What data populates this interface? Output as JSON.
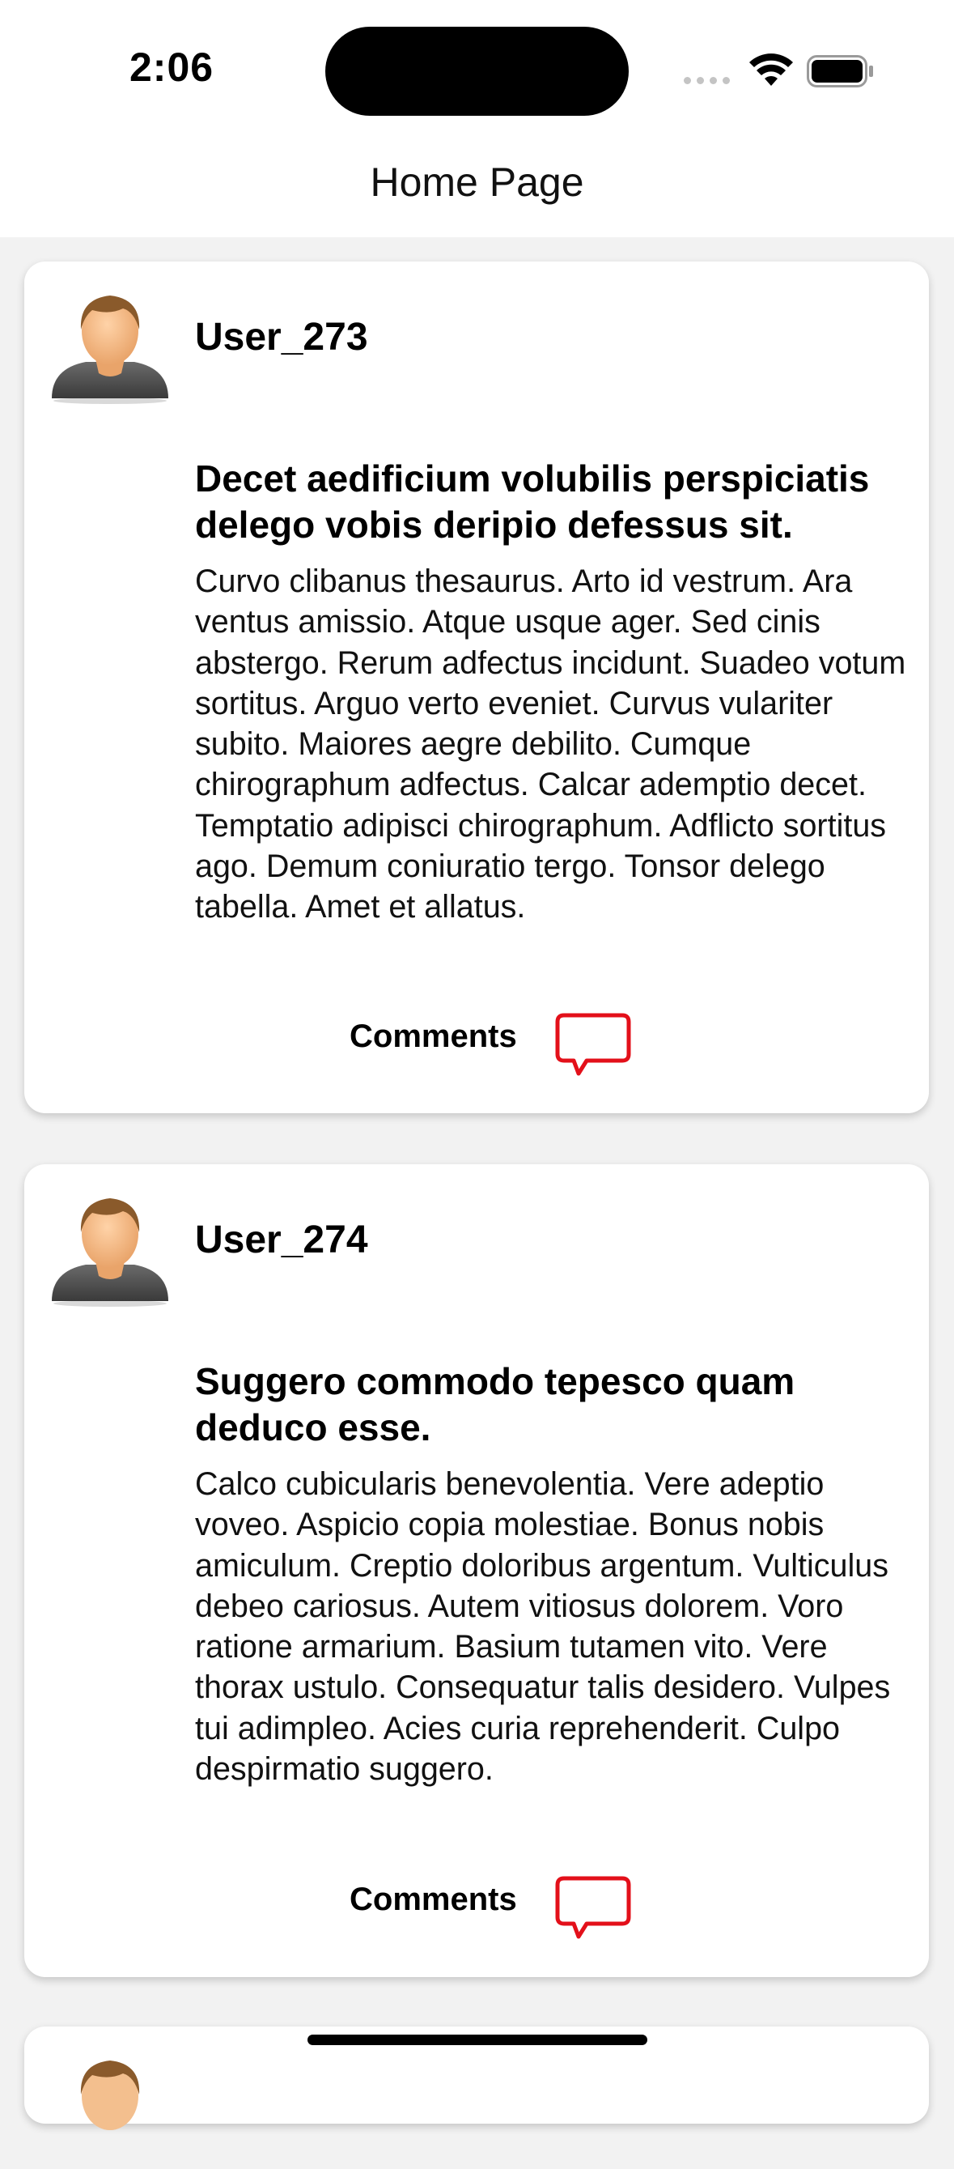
{
  "status_bar": {
    "time": "2:06"
  },
  "header": {
    "title": "Home Page"
  },
  "posts": [
    {
      "user": "User_273",
      "title": "Decet aedificium volubilis perspiciatis delego vobis deripio defessus sit.",
      "body": "Curvo clibanus thesaurus. Arto id vestrum. Ara ventus amissio. Atque usque ager. Sed cinis abstergo. Rerum adfectus incidunt. Suadeo votum sortitus. Arguo verto eveniet. Curvus vulariter subito. Maiores aegre debilito. Cumque chirographum adfectus. Calcar ademptio decet. Temptatio adipisci chirographum. Adflicto sortitus ago. Demum coniuratio tergo. Tonsor delego tabella. Amet et allatus.",
      "comments_label": "Comments"
    },
    {
      "user": "User_274",
      "title": "Suggero commodo tepesco quam deduco esse.",
      "body": "Calco cubicularis benevolentia. Vere adeptio voveo. Aspicio copia molestiae. Bonus nobis amiculum. Creptio doloribus argentum. Vulticulus debeo cariosus. Autem vitiosus dolorem. Voro ratione armarium. Basium tutamen vito. Vere thorax ustulo. Consequatur talis desidero. Vulpes tui adimpleo. Acies curia reprehenderit. Culpo despirmatio suggero.",
      "comments_label": "Comments"
    }
  ],
  "colors": {
    "accent": "#e3101a",
    "background": "#f2f2f2",
    "card": "#ffffff"
  },
  "icons": [
    "wifi-icon",
    "battery-icon",
    "avatar",
    "comment-bubble-icon"
  ]
}
